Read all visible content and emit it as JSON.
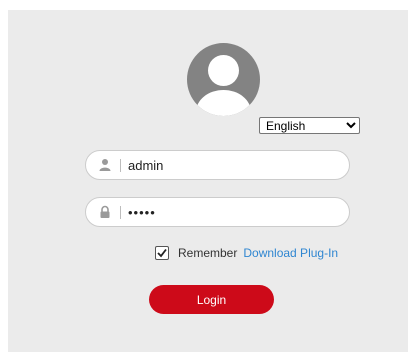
{
  "language": {
    "selected": "English",
    "options": [
      "English"
    ]
  },
  "username": {
    "value": "admin",
    "icon": "user-icon"
  },
  "password": {
    "value": "admin",
    "icon": "lock-icon"
  },
  "remember": {
    "label": "Remember",
    "checked": true
  },
  "plugin_link": "Download Plug-In",
  "login_button": "Login",
  "colors": {
    "background": "#ebebeb",
    "accent": "#cd0a19",
    "link": "#2f86d1",
    "avatar": "#838383"
  }
}
